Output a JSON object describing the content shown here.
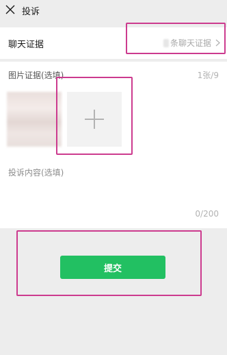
{
  "header": {
    "close_icon": "close-icon",
    "title": "投诉"
  },
  "chat_evidence": {
    "label": "聊天证据",
    "value": "条聊天证据",
    "chevron_icon": "chevron-right-icon"
  },
  "image_evidence": {
    "label": "图片证据(选填)",
    "count": "1张/9",
    "add_icon": "plus-icon"
  },
  "content": {
    "placeholder": "投诉内容(选填)",
    "count": "0/200"
  },
  "submit": {
    "label": "提交",
    "color": "#22c062"
  },
  "colors": {
    "highlight": "#cc3a8e",
    "background": "#ededed"
  }
}
